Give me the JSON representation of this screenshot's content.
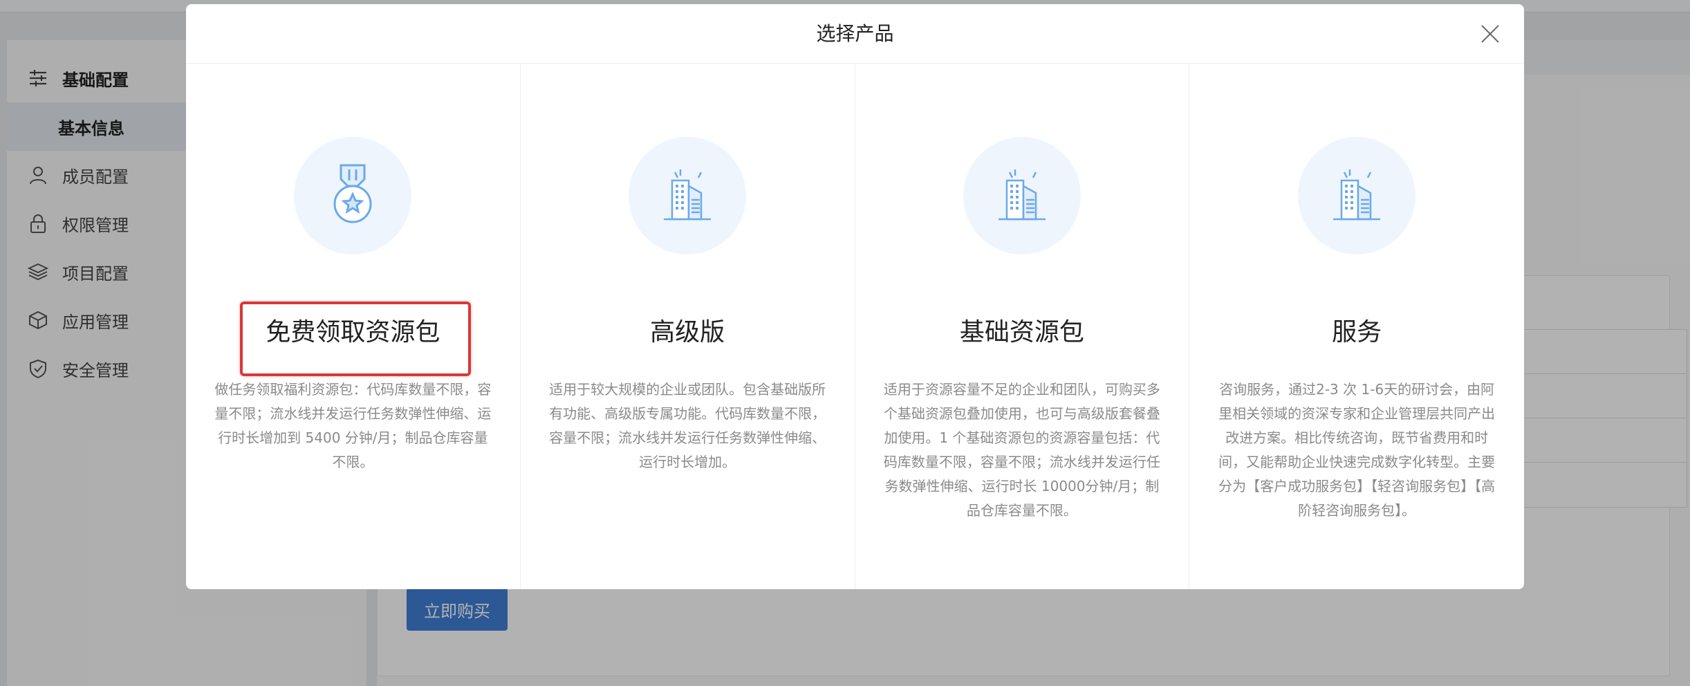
{
  "sidebar": {
    "items": [
      {
        "label": "基础配置",
        "icon": "sliders-icon",
        "kind": "group"
      },
      {
        "label": "基本信息",
        "icon": "",
        "kind": "sub"
      },
      {
        "label": "成员配置",
        "icon": "user-icon",
        "kind": "item"
      },
      {
        "label": "权限管理",
        "icon": "lock-icon",
        "kind": "item"
      },
      {
        "label": "项目配置",
        "icon": "layers-icon",
        "kind": "item"
      },
      {
        "label": "应用管理",
        "icon": "cube-icon",
        "kind": "item"
      },
      {
        "label": "安全管理",
        "icon": "shield-check-icon",
        "kind": "item"
      }
    ]
  },
  "main": {
    "buy_button": "立即购买"
  },
  "modal": {
    "title": "选择产品",
    "close_icon": "close-icon",
    "products": [
      {
        "name": "免费领取资源包",
        "icon": "medal-icon",
        "description": "做任务领取福利资源包：代码库数量不限，容量不限；流水线并发运行任务数弹性伸缩、运行时长增加到 5400 分钟/月；制品仓库容量不限。",
        "highlighted": true
      },
      {
        "name": "高级版",
        "icon": "building-icon",
        "description": "适用于较大规模的企业或团队。包含基础版所有功能、高级版专属功能。代码库数量不限，容量不限；流水线并发运行任务数弹性伸缩、运行时长增加。",
        "highlighted": false
      },
      {
        "name": "基础资源包",
        "icon": "building-icon",
        "description": "适用于资源容量不足的企业和团队，可购买多个基础资源包叠加使用，也可与高级版套餐叠加使用。1 个基础资源包的资源容量包括：代码库数量不限，容量不限；流水线并发运行任务数弹性伸缩、运行时长 10000分钟/月；制品仓库容量不限。",
        "highlighted": false
      },
      {
        "name": "服务",
        "icon": "building-icon",
        "description": "咨询服务，通过2-3 次 1-6天的研讨会，由阿里相关领域的资深专家和企业管理层共同产出改进方案。相比传统咨询，既节省费用和时间，又能帮助企业快速完成数字化转型。主要分为【客户成功服务包】【轻咨询服务包】【高阶轻咨询服务包】。",
        "highlighted": false
      }
    ]
  },
  "colors": {
    "accent": "#3f7fd6",
    "highlight": "#d7393b",
    "icon_bg": "#eef5fd",
    "icon_stroke": "#6aa9ea"
  }
}
